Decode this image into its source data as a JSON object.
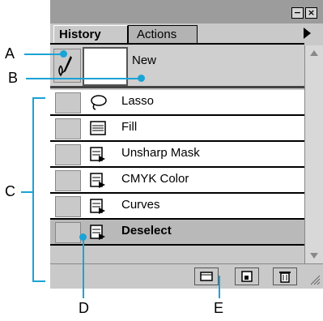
{
  "palette": {
    "window_buttons": [
      "−",
      "×"
    ],
    "tabs": [
      {
        "label": "History",
        "active": true
      },
      {
        "label": "Actions",
        "active": false
      }
    ],
    "snapshot": {
      "label": "New"
    },
    "history_items": [
      {
        "label": "Lasso",
        "icon": "lasso-icon",
        "selected": false
      },
      {
        "label": "Fill",
        "icon": "fill-icon",
        "selected": false
      },
      {
        "label": "Unsharp Mask",
        "icon": "history-state-icon",
        "selected": false
      },
      {
        "label": "CMYK Color",
        "icon": "history-state-icon",
        "selected": false
      },
      {
        "label": "Curves",
        "icon": "history-state-icon",
        "selected": false
      },
      {
        "label": "Deselect",
        "icon": "history-state-icon",
        "selected": true
      }
    ],
    "bottom_buttons": [
      "new-document-icon",
      "new-snapshot-icon",
      "trash-icon"
    ]
  },
  "callouts": [
    "A",
    "B",
    "C",
    "D",
    "E"
  ],
  "colors": {
    "callout_line": "#1aa3d6",
    "panel_bg": "#c9c9c9",
    "selected_row": "#b9b9b9"
  }
}
